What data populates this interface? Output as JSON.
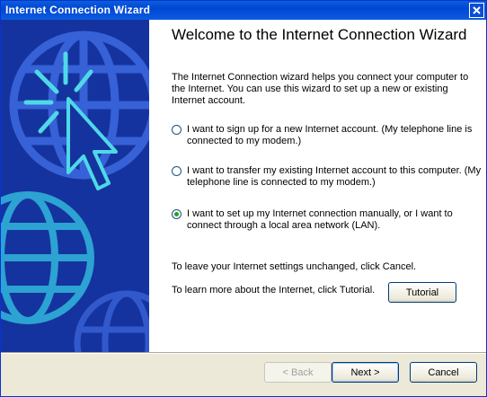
{
  "window": {
    "title": "Internet Connection Wizard"
  },
  "content": {
    "heading": "Welcome to the Internet Connection Wizard",
    "intro": "The Internet Connection wizard helps you connect your computer to the Internet.  You can use this wizard to set up a new or existing Internet account.",
    "options": [
      {
        "label": "I want to sign up for a new Internet account. (My telephone line is connected to my modem.)",
        "checked": false
      },
      {
        "label": "I want to transfer my existing Internet account to this computer. (My telephone line is connected to my modem.)",
        "checked": false
      },
      {
        "label": "I want to set up my Internet connection manually, or I want to connect through a local area network (LAN).",
        "checked": true
      }
    ],
    "cancel_note": "To leave your Internet settings unchanged, click Cancel.",
    "tutorial_note": "To learn more about the Internet, click Tutorial.",
    "tutorial_label": "Tutorial"
  },
  "buttons": {
    "back_label": "< Back",
    "next_label": "Next >",
    "cancel_label": "Cancel"
  },
  "icons": {
    "close": "close-icon",
    "side_art": "globe-cursor-illustration"
  },
  "colors": {
    "titlebar": "#0046d5",
    "side_panel": "#15339e",
    "radio_dot": "#21a121"
  }
}
